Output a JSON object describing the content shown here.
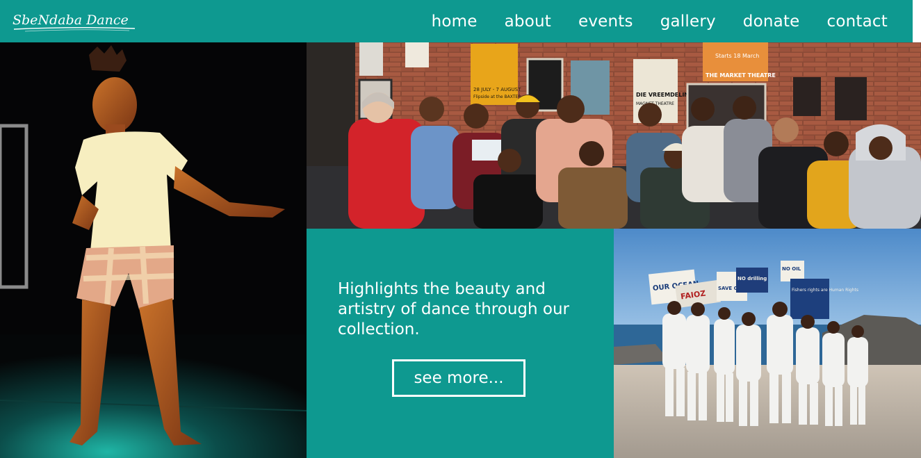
{
  "header": {
    "logo_text": "SbeNdaba Dance",
    "nav": [
      "home",
      "about",
      "events",
      "gallery",
      "donate",
      "contact"
    ]
  },
  "feature_card": {
    "tagline": "Highlights the beauty and artistry of dance through our collection.",
    "button_label": "see more..."
  },
  "poster_texts": {
    "p1": "28 JULY - 7 AUGUST",
    "p2": "Starts 18 March",
    "p3": "THE MARKET THEATRE",
    "p4": "DIE VREEMDELING",
    "p5": "MAGNET THEATRE",
    "p6": "Flipside at the BAXTER"
  },
  "protest_signs": {
    "s1": "OUR OCEAN",
    "s2": "SAVE OUR OCEAN",
    "s3": "NO drilling",
    "s4": "NO OIL",
    "s5": "Fishers rights are Human Rights",
    "s6": "FAIOZ"
  },
  "colors": {
    "brand_teal": "#0e9990",
    "white": "#ffffff"
  }
}
